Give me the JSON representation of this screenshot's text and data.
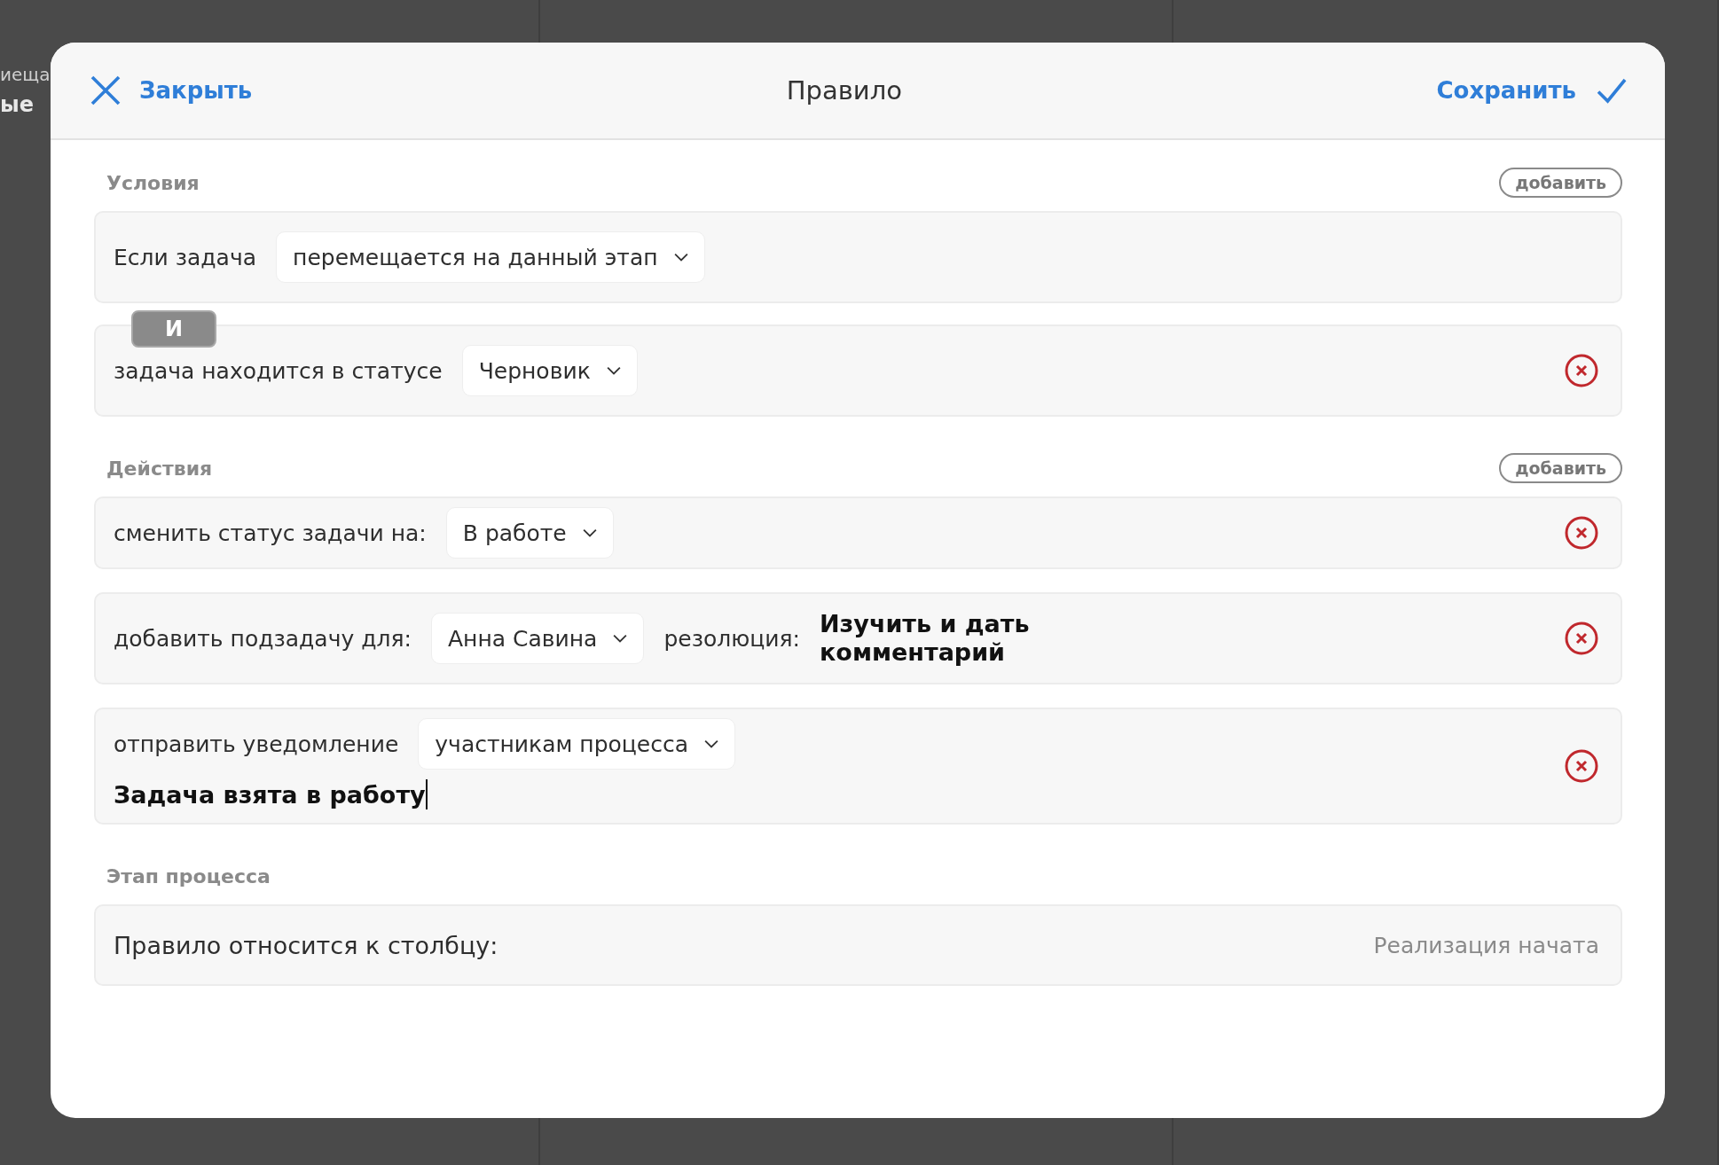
{
  "background_board": {
    "lines": [
      "иеща",
      "ые"
    ]
  },
  "dialog": {
    "close_label": "Закрыть",
    "title": "Правило",
    "save_label": "Сохранить"
  },
  "conditions": {
    "heading": "Условия",
    "add_label": "добавить",
    "items": [
      {
        "label": "Если задача",
        "dropdown": "перемещается на данный этап",
        "removable": false
      },
      {
        "connector": "И",
        "label": "задача находится в статусе",
        "dropdown": "Черновик",
        "removable": true
      }
    ]
  },
  "actions": {
    "heading": "Действия",
    "add_label": "добавить",
    "items": [
      {
        "kind": "status",
        "label": "сменить статус задачи на:",
        "dropdown": "В работе"
      },
      {
        "kind": "subtask",
        "label": "добавить подзадачу для:",
        "dropdown": "Анна Савина",
        "extra_label": "резолюция:",
        "extra_value": "Изучить и дать комментарий"
      },
      {
        "kind": "notify",
        "label": "отправить уведомление",
        "dropdown": "участникам процесса",
        "message": "Задача взята в работу"
      }
    ]
  },
  "stage": {
    "heading": "Этап процесса",
    "label": "Правило относится к столбцу:",
    "value": "Реализация начата"
  }
}
